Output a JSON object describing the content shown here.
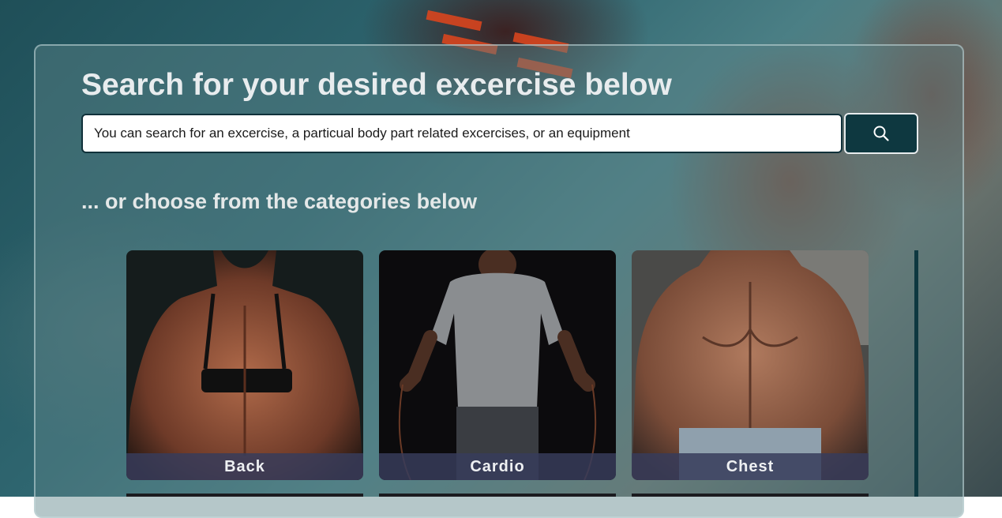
{
  "page": {
    "title": "Search for your desired excercise below",
    "subtitle": "... or choose from the categories below"
  },
  "search": {
    "placeholder": "You can search for an excercise, a particual body part related excercises, or an equipment",
    "button_icon": "search-icon"
  },
  "categories": [
    {
      "label": "Back"
    },
    {
      "label": "Cardio"
    },
    {
      "label": "Chest"
    }
  ],
  "colors": {
    "accent": "#0e3840",
    "label_band": "#373c5a",
    "title_text": "#e8ecee"
  }
}
